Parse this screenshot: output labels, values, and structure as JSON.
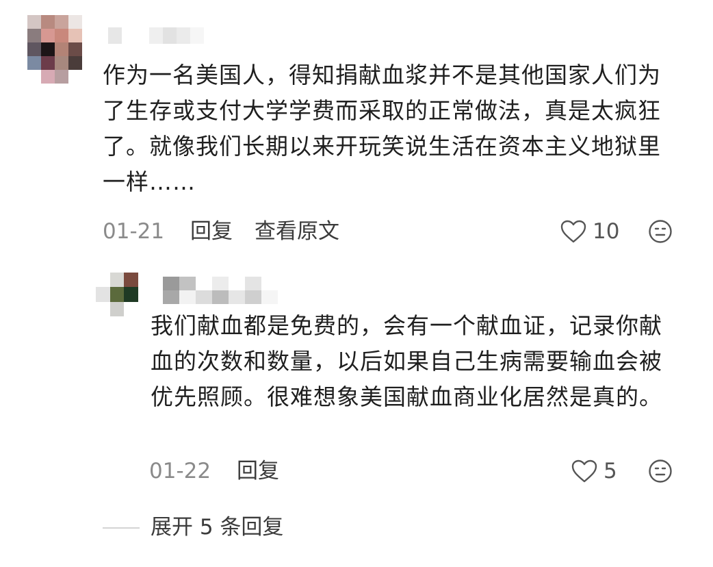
{
  "comment": {
    "text": "作为一名美国人，得知捐献血浆并不是其他国家人们为了生存或支付大学学费而采取的正常做法，真是太疯狂了。就像我们长期以来开玩笑说生活在资本主义地狱里一样……",
    "date": "01-21",
    "reply_label": "回复",
    "view_original_label": "查看原文",
    "like_count": "10"
  },
  "reply": {
    "text": "我们献血都是免费的，会有一个献血证，记录你献血的次数和数量，以后如果自己生病需要输血会被优先照顾。很难想象美国献血商业化居然是真的。",
    "date": "01-22",
    "reply_label": "回复",
    "like_count": "5"
  },
  "expand_replies_label": "展开 5 条回复",
  "icons": {
    "like": "heart-outline-icon",
    "emoji": "emoji-icon"
  },
  "colors": {
    "text": "#1f1f1f",
    "meta": "#8a8a8a",
    "action": "#3b3b3b"
  }
}
